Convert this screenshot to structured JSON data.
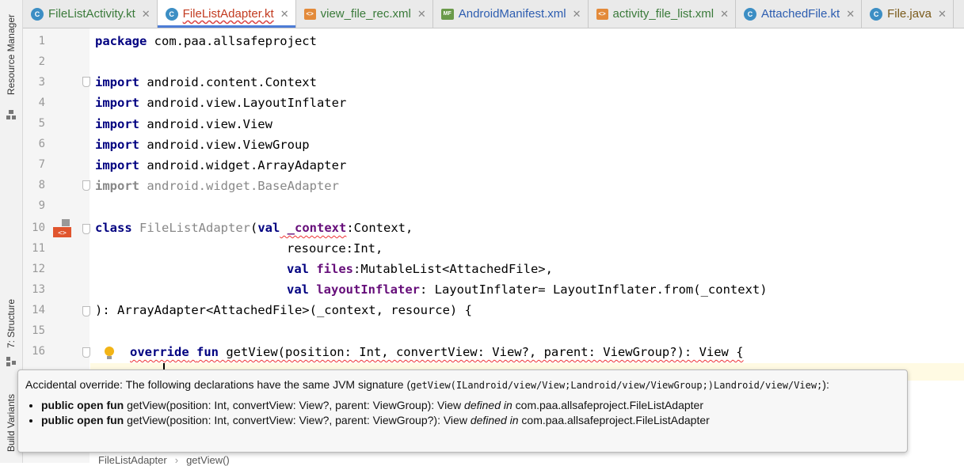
{
  "tabs": [
    {
      "label": "FileListActivity.kt",
      "icon": "kotlin-file-icon",
      "style": "green"
    },
    {
      "label": "FileListAdapter.kt",
      "icon": "kotlin-file-icon",
      "style": "red",
      "active": true
    },
    {
      "label": "view_file_rec.xml",
      "icon": "xml-layout-icon",
      "style": "green"
    },
    {
      "label": "AndroidManifest.xml",
      "icon": "manifest-file-icon",
      "style": "blue"
    },
    {
      "label": "activity_file_list.xml",
      "icon": "xml-layout-icon",
      "style": "green"
    },
    {
      "label": "AttachedFile.kt",
      "icon": "kotlin-file-icon",
      "style": "blue"
    },
    {
      "label": "File.java",
      "icon": "java-file-icon",
      "style": "brown"
    }
  ],
  "sidebar": {
    "resource_manager": "Resource Manager",
    "structure": "7: Structure",
    "build_variants": "Build Variants"
  },
  "editor": {
    "line_numbers": [
      "1",
      "2",
      "3",
      "4",
      "5",
      "6",
      "7",
      "8",
      "9",
      "10",
      "11",
      "12",
      "13",
      "14",
      "15",
      "16"
    ],
    "lines": {
      "l1_kw": "package",
      "l1_rest": " com.paa.allsafeproject",
      "l3_kw": "import",
      "l3_rest": " android.content.Context",
      "l4_kw": "import",
      "l4_rest": " android.view.LayoutInflater",
      "l5_kw": "import",
      "l5_rest": " android.view.View",
      "l6_kw": "import",
      "l6_rest": " android.view.ViewGroup",
      "l7_kw": "import",
      "l7_rest": " android.widget.ArrayAdapter",
      "l8_kw": "import",
      "l8_rest": " android.widget.BaseAdapter",
      "l10_kw": "class",
      "l10_name": " FileListAdapter",
      "l10_a": "(",
      "l10_val": "val",
      "l10_param": " _context",
      "l10_rest": ":Context,",
      "l11": "resource:Int,",
      "l12_val": "val",
      "l12_prop": " files",
      "l12_rest": ":MutableList<AttachedFile>,",
      "l13_val": "val",
      "l13_prop": " layoutInflater",
      "l13_rest": ": LayoutInflater= LayoutInflater.from(_context)",
      "l14": "): ArrayAdapter<AttachedFile>(_context, resource) {",
      "l16_kw1": "override",
      "l16_kw2": "fun",
      "l16_rest": " getView(position: Int, convertView: View?, parent: ViewGroup?): View {"
    }
  },
  "tooltip": {
    "lead": "Accidental override: The following declarations have the same JVM signature (",
    "signature": "getView(ILandroid/view/View;Landroid/view/ViewGroup;)Landroid/view/View;",
    "tail": "):",
    "items": [
      {
        "bold": "public open fun",
        "text": " getView(position: Int, convertView: View?, parent: ViewGroup): View ",
        "italic": "defined in",
        "owner": " com.paa.allsafeproject.FileListAdapter"
      },
      {
        "bold": "public open fun",
        "text": " getView(position: Int, convertView: View?, parent: ViewGroup?): View ",
        "italic": "defined in",
        "owner": " com.paa.allsafeproject.FileListAdapter"
      }
    ]
  },
  "breadcrumb": {
    "class": "FileListAdapter",
    "method": "getView()",
    "separator": "›"
  }
}
